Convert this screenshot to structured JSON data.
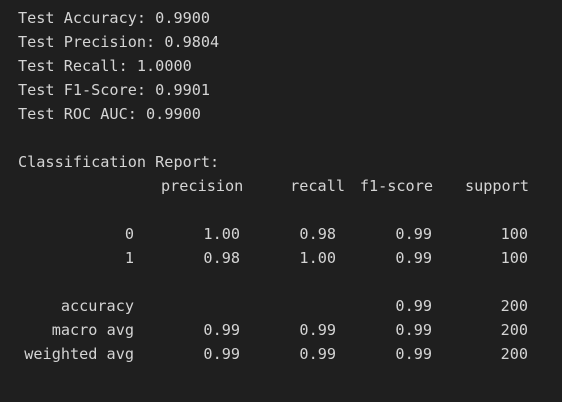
{
  "metrics": [
    {
      "label": "Test Accuracy:",
      "value": "0.9900"
    },
    {
      "label": "Test Precision:",
      "value": "0.9804"
    },
    {
      "label": "Test Recall:",
      "value": "1.0000"
    },
    {
      "label": "Test F1-Score:",
      "value": "0.9901"
    },
    {
      "label": "Test ROC AUC:",
      "value": "0.9900"
    }
  ],
  "report": {
    "title": "Classification Report:",
    "headers": {
      "precision": "precision",
      "recall": "recall",
      "f1": "f1-score",
      "support": "support"
    },
    "class_rows": [
      {
        "label": "0",
        "precision": "1.00",
        "recall": "0.98",
        "f1": "0.99",
        "support": "100"
      },
      {
        "label": "1",
        "precision": "0.98",
        "recall": "1.00",
        "f1": "0.99",
        "support": "100"
      }
    ],
    "accuracy_row": {
      "label": "accuracy",
      "f1": "0.99",
      "support": "200"
    },
    "avg_rows": [
      {
        "label": "macro avg",
        "precision": "0.99",
        "recall": "0.99",
        "f1": "0.99",
        "support": "200"
      },
      {
        "label": "weighted avg",
        "precision": "0.99",
        "recall": "0.99",
        "f1": "0.99",
        "support": "200"
      }
    ]
  }
}
